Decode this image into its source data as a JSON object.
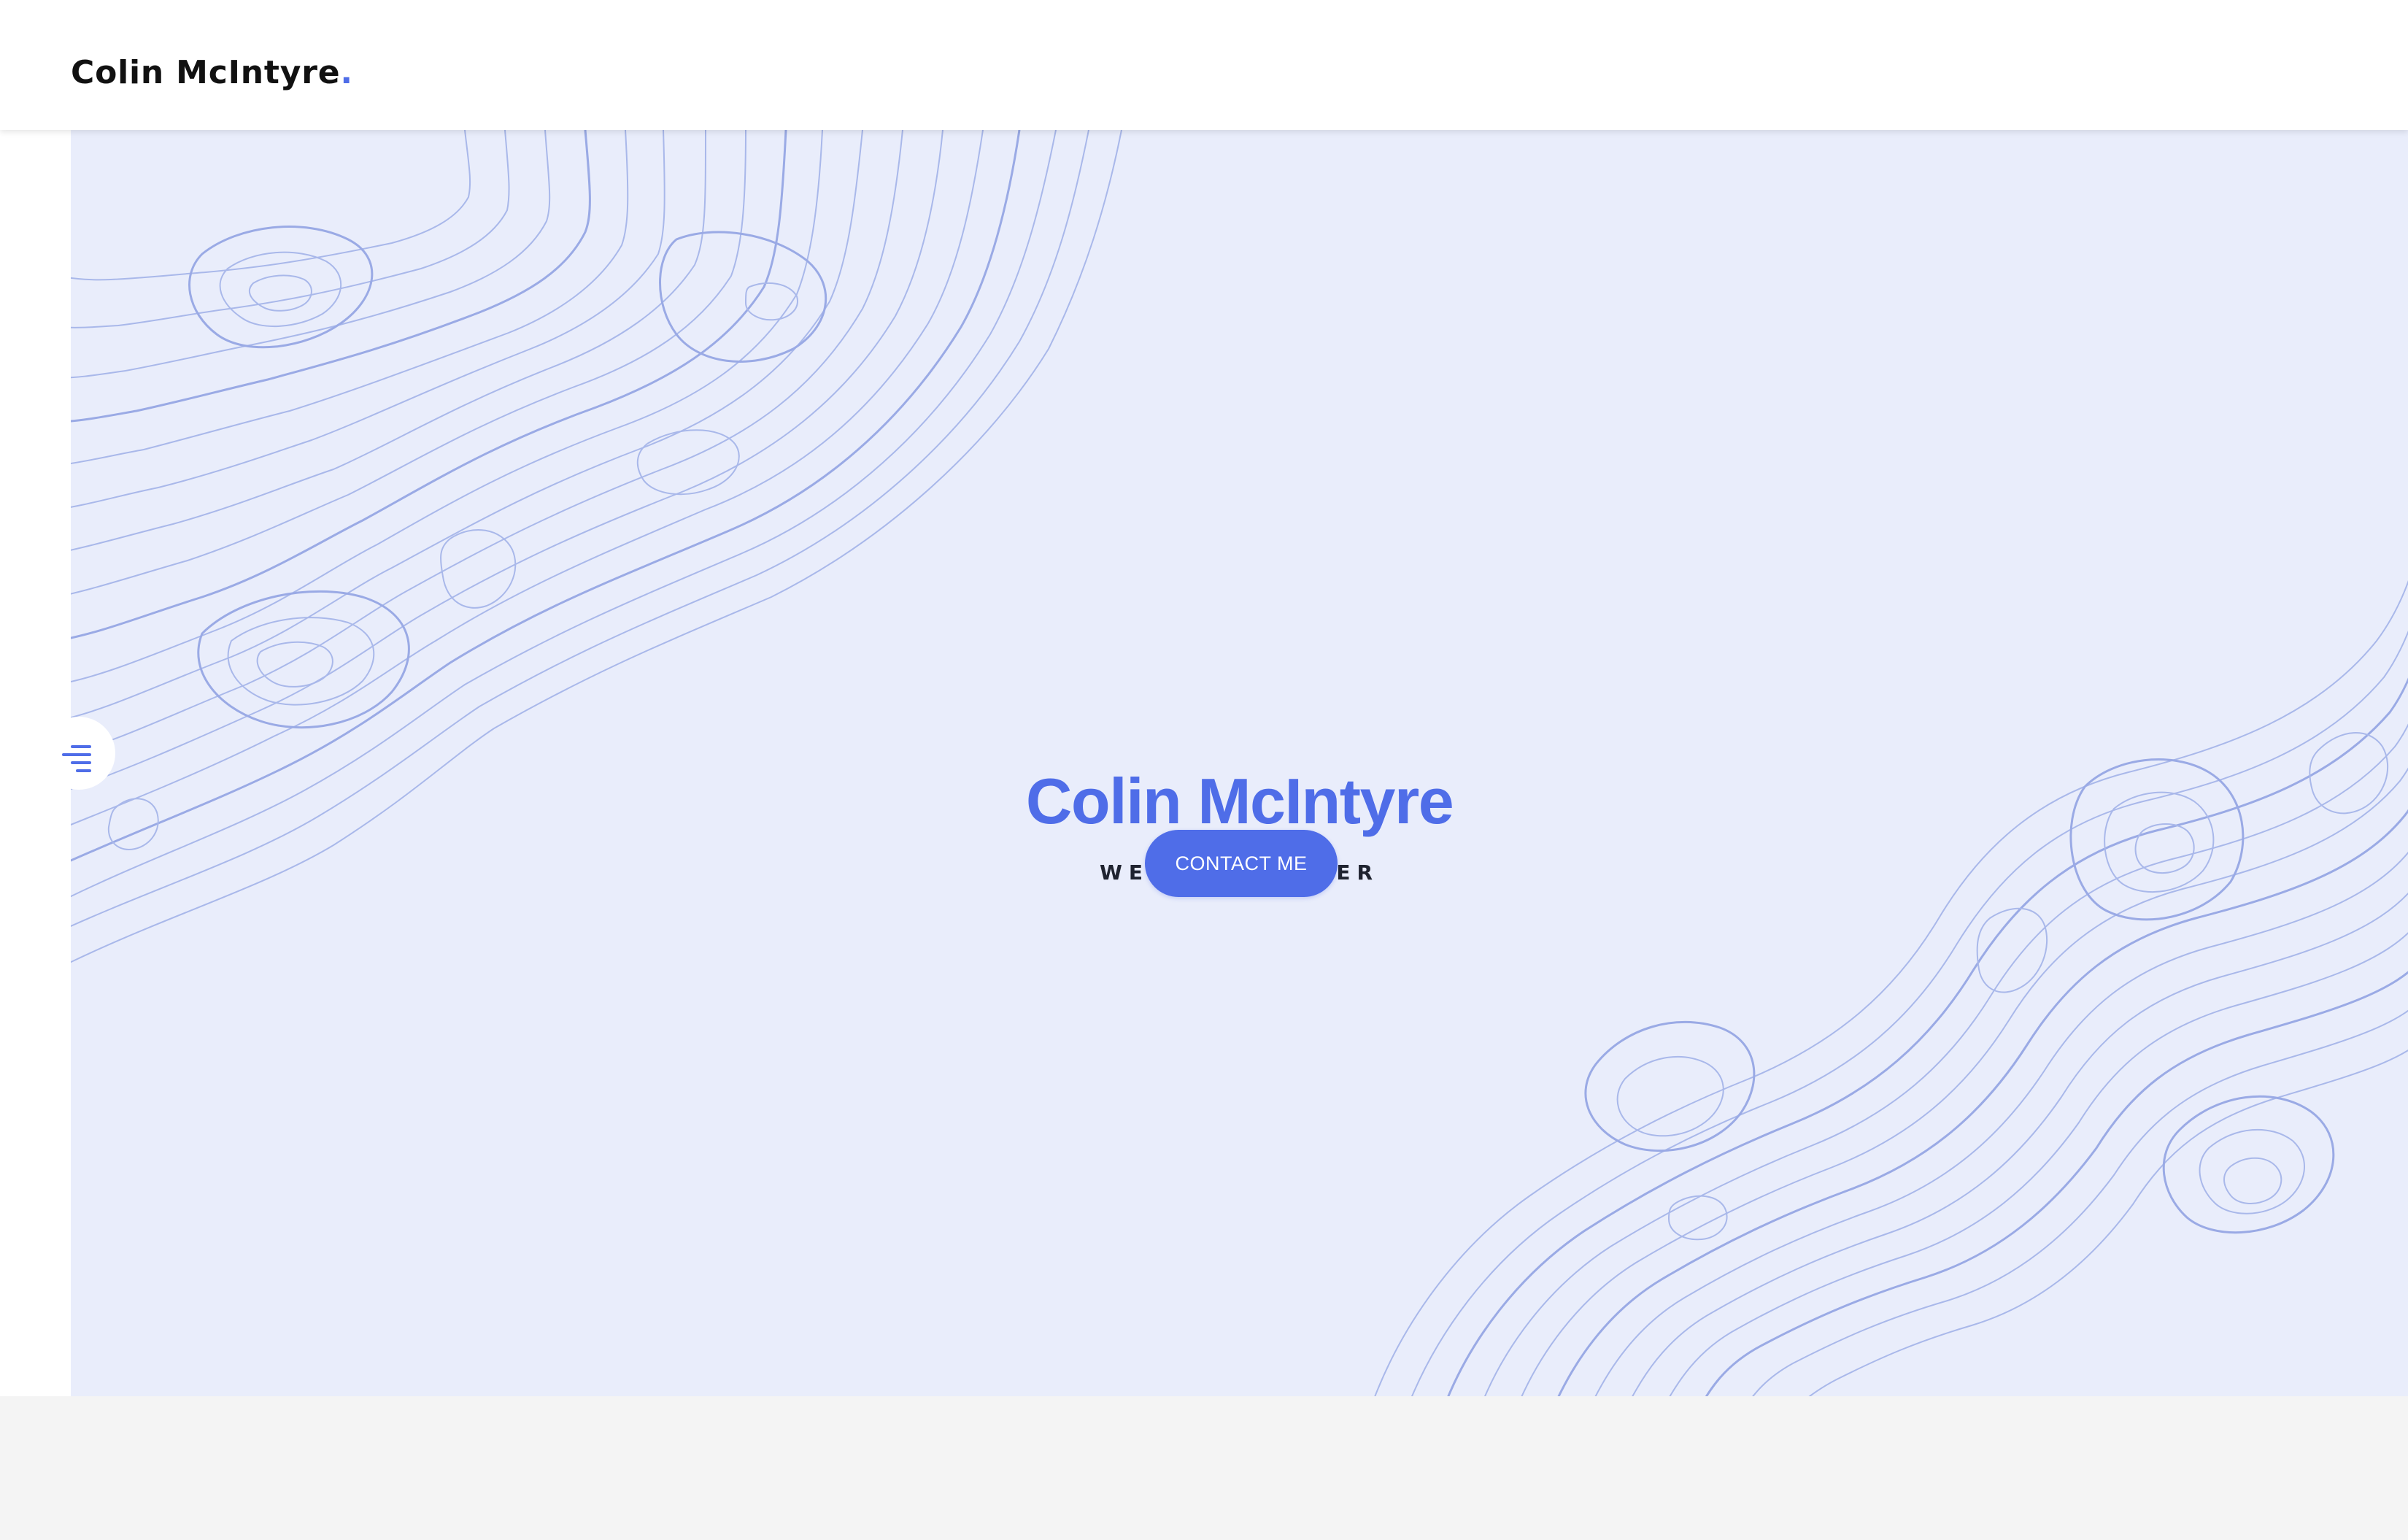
{
  "header": {
    "brand_name": "Colin McIntyre",
    "brand_dot": "."
  },
  "hero": {
    "title": "Colin McIntyre",
    "subtitle": "WEB DEVELOPER",
    "cta_label": "CONTACT ME"
  },
  "menu": {
    "icon": "hamburger-menu-icon"
  },
  "colors": {
    "accent": "#4f6de8",
    "hero_background": "#e9edfb",
    "topo_lines": "#a9b8ea",
    "text_dark": "#1f2330"
  }
}
